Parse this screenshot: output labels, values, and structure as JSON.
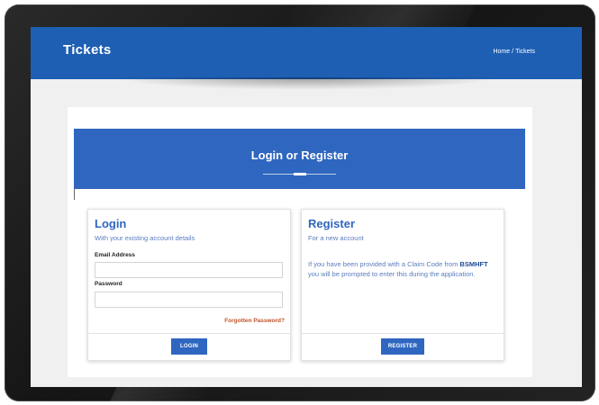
{
  "header": {
    "title": "Tickets",
    "breadcrumb": [
      "Home",
      "Tickets"
    ],
    "breadcrumb_separator": "/"
  },
  "hero": {
    "title": "Login or Register"
  },
  "login": {
    "heading": "Login",
    "subtitle": "With your existing account details",
    "email_label": "Email Address",
    "email_value": "",
    "password_label": "Password",
    "password_value": "",
    "forgot_link": "Forgotten Password?",
    "button_label": "LOGIN"
  },
  "register": {
    "heading": "Register",
    "subtitle": "For a new account",
    "text_before": "If you have been provided with a Claim Code from ",
    "text_bold": "BSMHFT",
    "text_after": " you will be prompted to enter this during the application.",
    "button_label": "REGISTER"
  },
  "colors": {
    "brand_blue": "#1e5fb4",
    "hero_blue": "#2f66bf",
    "link_orange": "#c0532a"
  }
}
